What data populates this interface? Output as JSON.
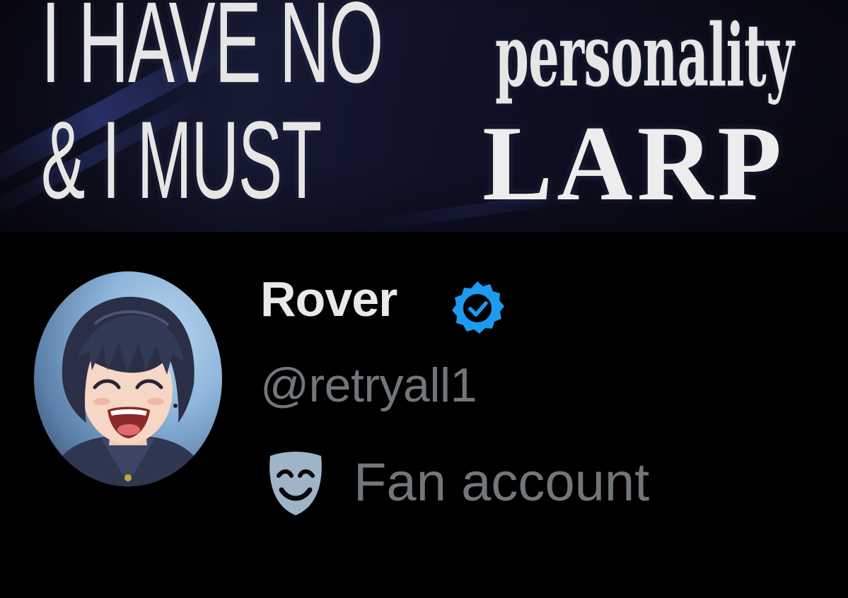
{
  "banner": {
    "line1": {
      "part_a": "I HAVE NO",
      "part_b": "personality"
    },
    "line2": {
      "part_a": "& I MUST",
      "part_b": "LARP"
    }
  },
  "profile": {
    "display_name": "Rover",
    "handle": "@retryall1",
    "label": "Fan account",
    "verified_icon": "verified-badge-icon",
    "label_icon": "theater-mask-icon",
    "colors": {
      "background": "#000000",
      "name": "#e7e9ea",
      "secondary_text": "#71767b",
      "verified_blue": "#1d9bf0",
      "mask": "#9fb4c7"
    }
  }
}
